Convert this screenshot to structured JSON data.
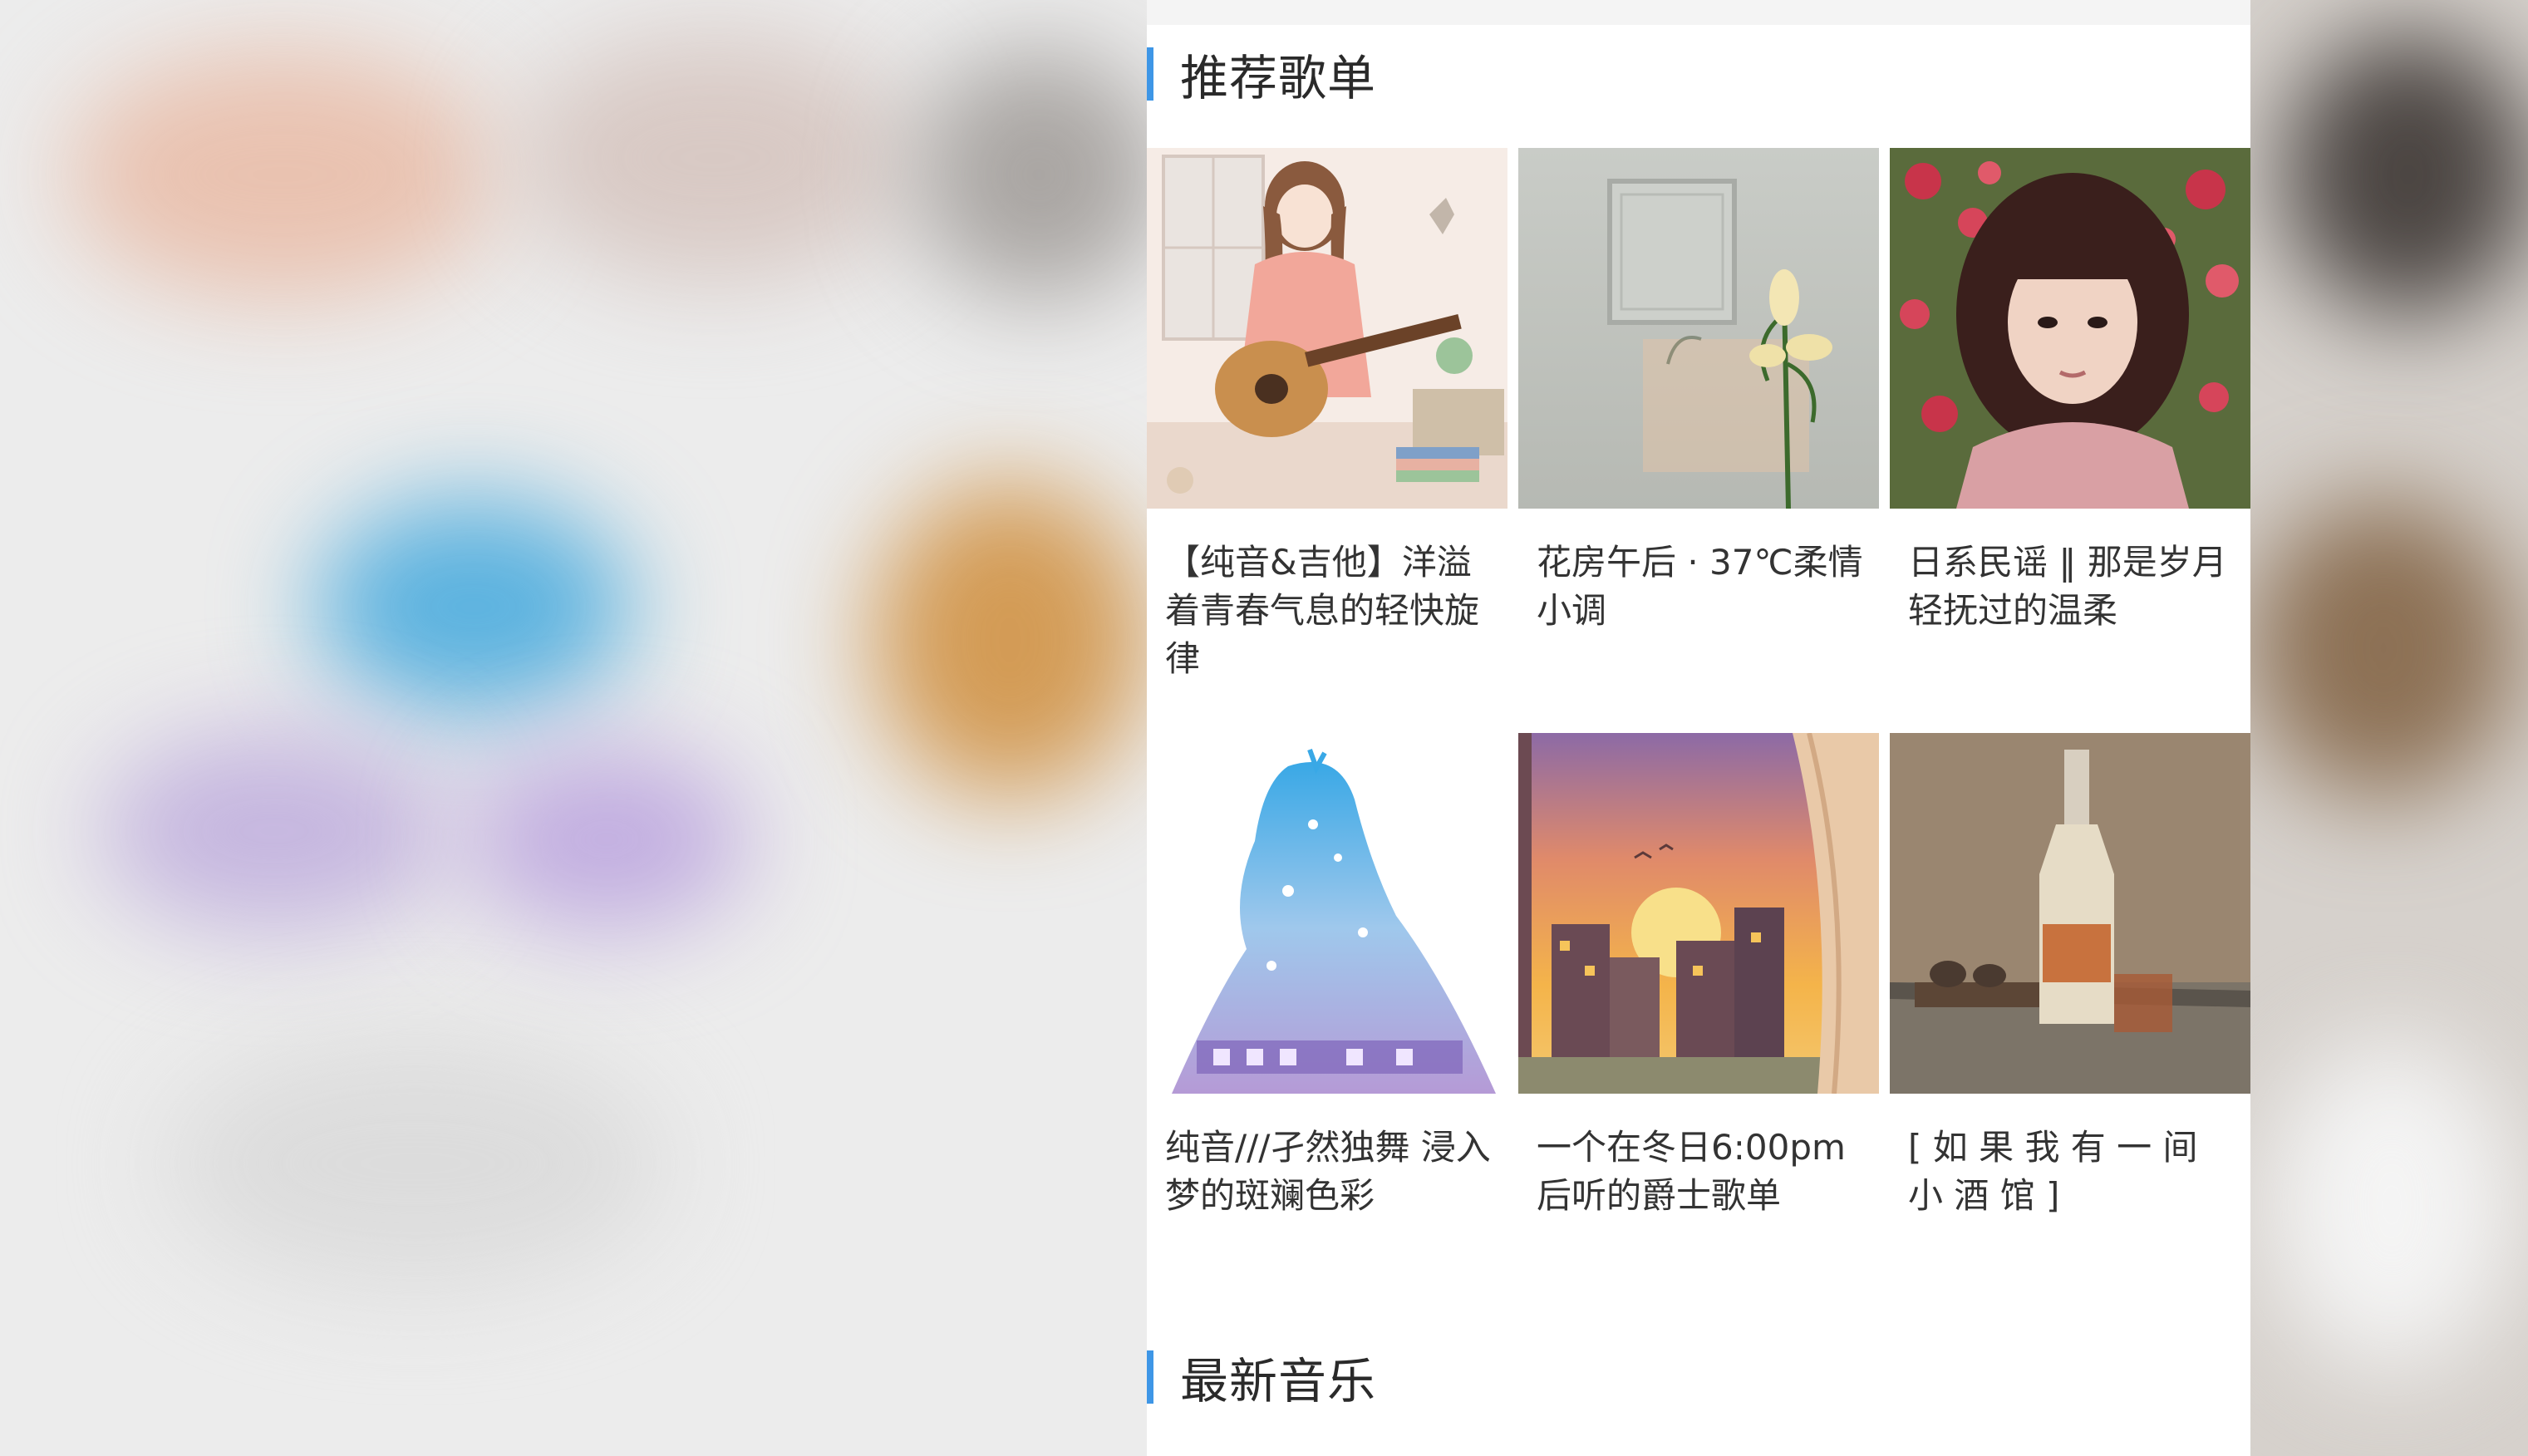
{
  "sections": {
    "recommended": {
      "title": "推荐歌单"
    },
    "latest": {
      "title": "最新音乐"
    }
  },
  "playlists": [
    {
      "title": "【纯音&吉他】洋溢着青春气息的轻快旋律"
    },
    {
      "title": "花房午后 · 37℃柔情小调"
    },
    {
      "title": "日系民谣 ‖ 那是岁月轻抚过的温柔"
    },
    {
      "title": "纯音///孑然独舞 浸入梦的斑斓色彩"
    },
    {
      "title": "一个在冬日6:00pm后听的爵士歌单"
    },
    {
      "title": "[ 如 果 我 有 一 间 小 酒 馆 ]"
    }
  ],
  "colors": {
    "accent": "#3e96e6",
    "text": "#333333",
    "panel_background": "#ffffff"
  }
}
